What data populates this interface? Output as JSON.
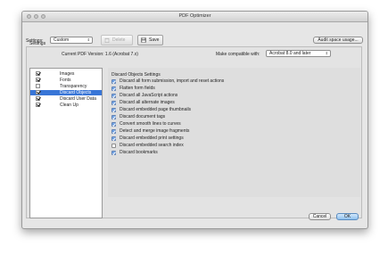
{
  "window": {
    "title": "PDF Optimizer"
  },
  "toolbar": {
    "settings_label": "Settings:",
    "settings_value": "Custom",
    "delete_label": "Delete",
    "save_label": "Save",
    "audit_label": "Audit space usage..."
  },
  "group": {
    "label": "Settings"
  },
  "version": {
    "current_label": "Current PDF Version: 1.6 (Acrobat 7.x)",
    "compat_label": "Make compatible with:",
    "compat_value": "Acrobat 8.0 and later"
  },
  "sidebar": {
    "items": [
      {
        "label": "Images",
        "checked": true,
        "selected": false
      },
      {
        "label": "Fonts",
        "checked": true,
        "selected": false
      },
      {
        "label": "Transparency",
        "checked": false,
        "selected": false
      },
      {
        "label": "Discard Objects",
        "checked": true,
        "selected": true
      },
      {
        "label": "Discard User Data",
        "checked": true,
        "selected": false
      },
      {
        "label": "Clean Up",
        "checked": true,
        "selected": false
      }
    ]
  },
  "pane": {
    "title": "Discard Objects Settings",
    "options": [
      {
        "label": "Discard all form submission, import and reset actions",
        "checked": true
      },
      {
        "label": "Flatten form fields",
        "checked": true
      },
      {
        "label": "Discard all JavaScript actions",
        "checked": true
      },
      {
        "label": "Discard all alternate images",
        "checked": true
      },
      {
        "label": "Discard embedded page thumbnails",
        "checked": true
      },
      {
        "label": "Discard document tags",
        "checked": true
      },
      {
        "label": "Convert smooth lines to curves",
        "checked": true
      },
      {
        "label": "Detect and merge image fragments",
        "checked": true
      },
      {
        "label": "Discard embedded print settings",
        "checked": true
      },
      {
        "label": "Discard embedded search index",
        "checked": false
      },
      {
        "label": "Discard bookmarks",
        "checked": true
      }
    ]
  },
  "footer": {
    "cancel_label": "Cancel",
    "ok_label": "OK"
  },
  "colors": {
    "selection": "#3875d7",
    "checkbox_on": "#3d7dd6",
    "window_bg": "#e6e6e6"
  }
}
